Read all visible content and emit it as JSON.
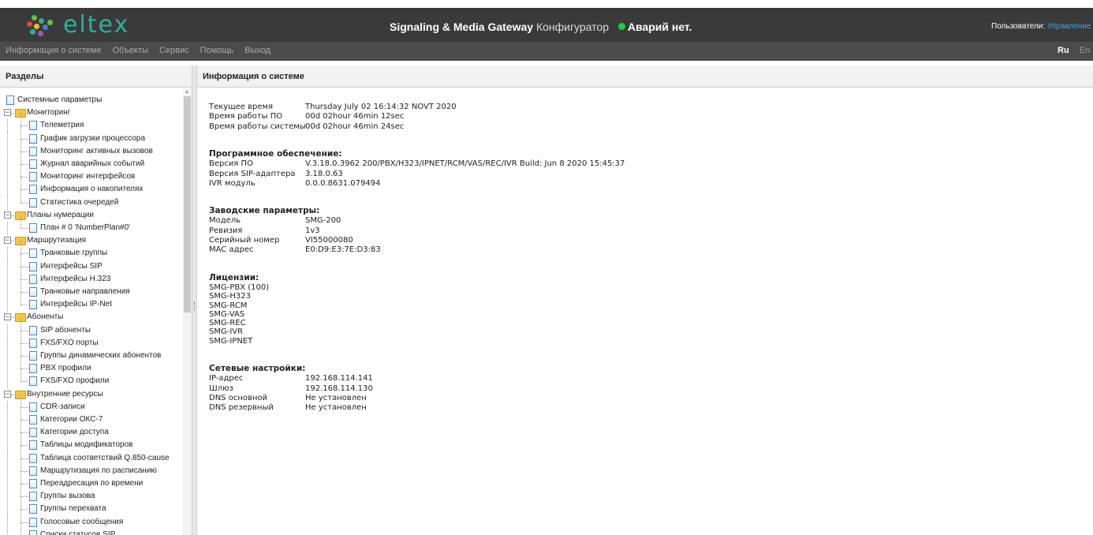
{
  "header": {
    "logo_text": "eltex",
    "title_bold": "Signaling & Media Gateway",
    "title_rest": "Конфигуратор",
    "alarm_text": "Аварий нет.",
    "users_label": "Пользователи:",
    "users_link": "Управление"
  },
  "menu": {
    "items": [
      "Информация о системе",
      "Объекты",
      "Сервис",
      "Помощь",
      "Выход"
    ],
    "lang_ru": "Ru",
    "lang_en": "En"
  },
  "sidebar": {
    "title": "Разделы",
    "tree": [
      {
        "label": "Системные параметры",
        "level": 0,
        "type": "doc"
      },
      {
        "label": "Мониторинг",
        "level": 0,
        "type": "folder"
      },
      {
        "label": "Телеметрия",
        "level": 1,
        "type": "doc"
      },
      {
        "label": "График загрузки процессора",
        "level": 1,
        "type": "doc"
      },
      {
        "label": "Мониторинг активных вызовов",
        "level": 1,
        "type": "doc"
      },
      {
        "label": "Журнал аварийных событий",
        "level": 1,
        "type": "doc"
      },
      {
        "label": "Мониторинг интерфейсов",
        "level": 1,
        "type": "doc"
      },
      {
        "label": "Информация о накопителях",
        "level": 1,
        "type": "doc"
      },
      {
        "label": "Статистика очередей",
        "level": 1,
        "type": "doc"
      },
      {
        "label": "Планы нумерации",
        "level": 0,
        "type": "folder"
      },
      {
        "label": "План # 0 'NumberPlan#0'",
        "level": 1,
        "type": "doc"
      },
      {
        "label": "Маршрутизация",
        "level": 0,
        "type": "folder"
      },
      {
        "label": "Транковые группы",
        "level": 1,
        "type": "doc"
      },
      {
        "label": "Интерфейсы SIP",
        "level": 1,
        "type": "doc"
      },
      {
        "label": "Интерфейсы H.323",
        "level": 1,
        "type": "doc"
      },
      {
        "label": "Транковые направления",
        "level": 1,
        "type": "doc"
      },
      {
        "label": "Интерфейсы IP-Net",
        "level": 1,
        "type": "doc"
      },
      {
        "label": "Абоненты",
        "level": 0,
        "type": "folder"
      },
      {
        "label": "SIP абоненты",
        "level": 1,
        "type": "doc"
      },
      {
        "label": "FXS/FXO порты",
        "level": 1,
        "type": "doc"
      },
      {
        "label": "Группы динамических абонентов",
        "level": 1,
        "type": "doc"
      },
      {
        "label": "PBX профили",
        "level": 1,
        "type": "doc"
      },
      {
        "label": "FXS/FXO профили",
        "level": 1,
        "type": "doc"
      },
      {
        "label": "Внутренние ресурсы",
        "level": 0,
        "type": "folder"
      },
      {
        "label": "CDR-записи",
        "level": 1,
        "type": "doc"
      },
      {
        "label": "Категории ОКС-7",
        "level": 1,
        "type": "doc"
      },
      {
        "label": "Категории доступа",
        "level": 1,
        "type": "doc"
      },
      {
        "label": "Таблицы модификаторов",
        "level": 1,
        "type": "doc"
      },
      {
        "label": "Таблица соответствий Q.850-cause",
        "level": 1,
        "type": "doc"
      },
      {
        "label": "Маршрутизация по расписанию",
        "level": 1,
        "type": "doc"
      },
      {
        "label": "Переадресация по времени",
        "level": 1,
        "type": "doc"
      },
      {
        "label": "Группы вызова",
        "level": 1,
        "type": "doc"
      },
      {
        "label": "Группы перехвата",
        "level": 1,
        "type": "doc"
      },
      {
        "label": "Голосовые сообщения",
        "level": 1,
        "type": "doc"
      },
      {
        "label": "Списки статусов SIP",
        "level": 1,
        "type": "doc"
      }
    ]
  },
  "main": {
    "title": "Информация о системе",
    "general": [
      {
        "label": "Текущее время",
        "value": "Thursday July 02 16:14:32 NOVT 2020"
      },
      {
        "label": "Время работы ПО",
        "value": "00d 02hour 46min 12sec"
      },
      {
        "label": "Время работы системы",
        "value": "00d 02hour 46min 24sec"
      }
    ],
    "software_title": "Программное обеспечение:",
    "software": [
      {
        "label": "Версия ПО",
        "value": "V.3.18.0.3962 200/PBX/H323/IPNET/RCM/VAS/REC/IVR Build: Jun 8 2020 15:45:37"
      },
      {
        "label": "Версия SIP-адаптера",
        "value": "3.18.0.63"
      },
      {
        "label": "IVR модуль",
        "value": "0.0.0.8631.079494"
      }
    ],
    "factory_title": "Заводские параметры:",
    "factory": [
      {
        "label": "Модель",
        "value": "SMG-200"
      },
      {
        "label": "Ревизия",
        "value": "1v3"
      },
      {
        "label": "Серийный номер",
        "value": "VI55000080"
      },
      {
        "label": "MAC адрес",
        "value": "E0:D9:E3:7E:D3:83"
      }
    ],
    "licenses_title": "Лицензии:",
    "licenses": [
      "SMG-PBX (100)",
      "SMG-H323",
      "SMG-RCM",
      "SMG-VAS",
      "SMG-REC",
      "SMG-IVR",
      "SMG-IPNET"
    ],
    "network_title": "Сетевые настройки:",
    "network": [
      {
        "label": "IP-адрес",
        "value": "192.168.114.141"
      },
      {
        "label": "Шлюз",
        "value": "192.168.114.130"
      },
      {
        "label": "DNS основной",
        "value": "Не установлен"
      },
      {
        "label": "DNS резервный",
        "value": "Не установлен"
      }
    ]
  },
  "colors": {
    "header_bg": "#3a3a3a",
    "menubar_bg": "#4b4b4b",
    "logo": "#2fae9b",
    "status_ok": "#1ecc3c",
    "link": "#39a4e6"
  }
}
